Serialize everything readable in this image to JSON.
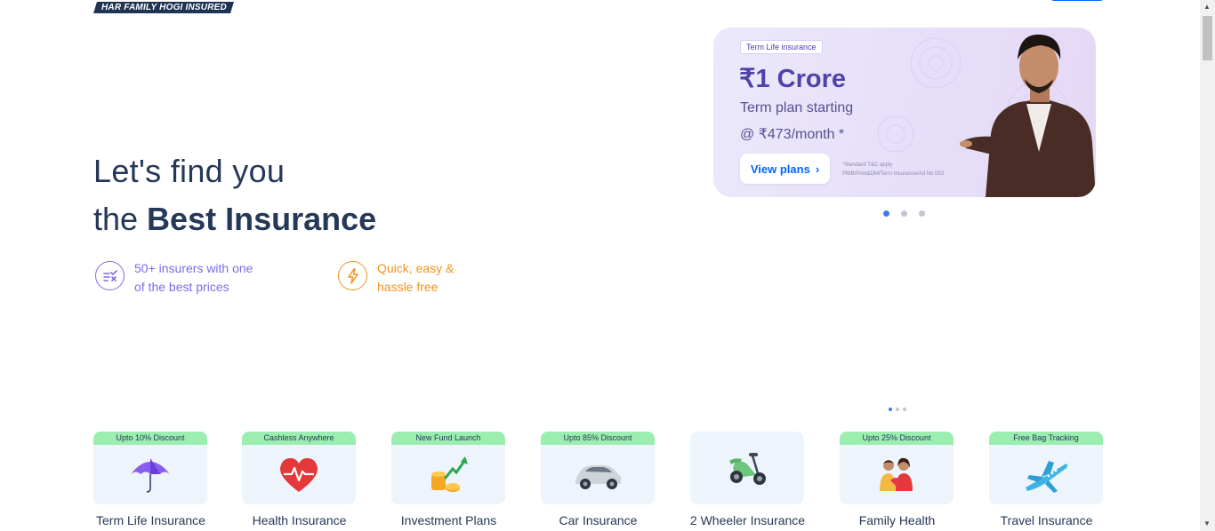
{
  "header": {
    "tagline": "HAR FAMILY HOGI INSURED"
  },
  "hero": {
    "line1": "Let's find you",
    "line2_prefix": "the ",
    "line2_bold": "Best Insurance",
    "features": [
      {
        "line1": "50+ insurers with one",
        "line2": "of the best prices",
        "icon": "compare-icon"
      },
      {
        "line1": "Quick, easy &",
        "line2": "hassle free",
        "icon": "lightning-icon"
      }
    ]
  },
  "banner": {
    "pill": "Term Life insurance",
    "amount": "₹1 Crore",
    "sub1": "Term plan starting",
    "sub2": "@ ₹473/month *",
    "button": "View plans",
    "tc1": "*Standard T&C apply",
    "tc2": "PBIB/Print&DM/Term Insurance/Ad No.053"
  },
  "products": [
    {
      "badge": "Upto 10% Discount",
      "label": "Term Life Insurance",
      "icon": "umbrella-icon"
    },
    {
      "badge": "Cashless Anywhere",
      "label": "Health Insurance",
      "icon": "heart-pulse-icon"
    },
    {
      "badge": "New Fund Launch",
      "label": "Investment Plans",
      "icon": "coins-growth-icon"
    },
    {
      "badge": "Upto 85% Discount",
      "label": "Car Insurance",
      "icon": "car-icon"
    },
    {
      "badge": "",
      "label": "2 Wheeler Insurance",
      "icon": "scooter-icon"
    },
    {
      "badge": "Upto 25% Discount",
      "label": "Family Health",
      "icon": "family-icon"
    },
    {
      "badge": "Free Bag Tracking",
      "label": "Travel Insurance",
      "icon": "airplane-icon"
    }
  ],
  "colors": {
    "brand_navy": "#253858",
    "accent_blue": "#0065ff",
    "badge_green": "#9beeb0",
    "feature_purple": "#7b6de8",
    "feature_orange": "#f2931f"
  }
}
